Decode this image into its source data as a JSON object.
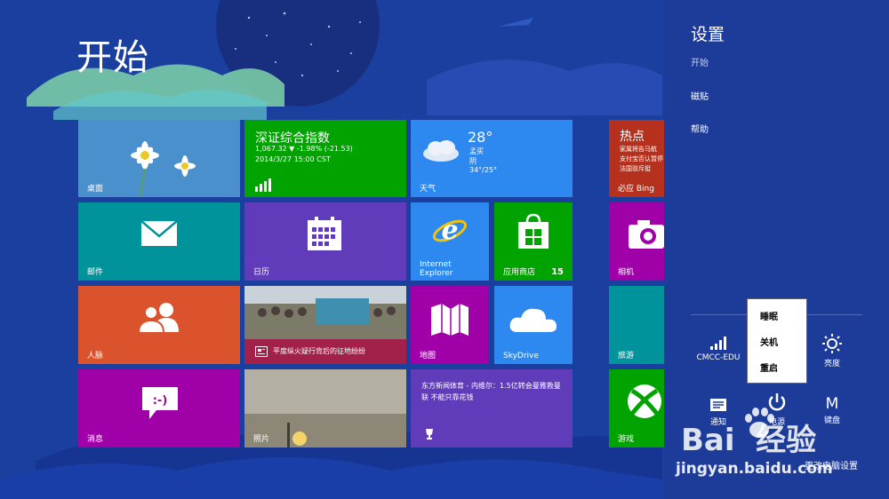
{
  "start": {
    "title": "开始"
  },
  "tiles": {
    "desktop": {
      "label": "桌面"
    },
    "stock": {
      "name": "深证综合指数",
      "line1": "1,067.32 ▼ -1.98% (-21.53)",
      "line2": "2014/3/27 15:00 CST"
    },
    "weather": {
      "temp": "28°",
      "city": "孟买",
      "cond": "阴",
      "range": "34°/25°",
      "label": "天气"
    },
    "news": {
      "title": "热点",
      "l1": "家属将告马航",
      "l2": "支付宝否认暂停",
      "l3": "法国驳斥挺",
      "label": "必应 Bing"
    },
    "mail": {
      "label": "邮件"
    },
    "calendar": {
      "label": "日历"
    },
    "ie": {
      "label": "Internet Explorer"
    },
    "store": {
      "label": "应用商店",
      "badge": "15"
    },
    "camera": {
      "label": "相机"
    },
    "people": {
      "label": "人脉"
    },
    "newsphoto": {
      "caption": "平度纵火疑行背后的征地纷纷"
    },
    "maps": {
      "label": "地图"
    },
    "skydrive": {
      "label": "SkyDrive"
    },
    "travel": {
      "label": "旅游"
    },
    "messaging": {
      "label": "消息"
    },
    "photos": {
      "label": "照片"
    },
    "sports": {
      "text": "东方新闻体育 - 内维尔：1.5亿转会曼雅救曼联 不能只靠花钱"
    },
    "games": {
      "label": "游戏"
    }
  },
  "charm": {
    "title": "设置",
    "subtitle": "开始",
    "items": [
      "磁贴",
      "帮助"
    ],
    "quick": {
      "network": "CMCC-EDU",
      "brightness": "亮度",
      "notifications": "通知",
      "power": "电源",
      "keyboard": "键盘",
      "keyboard_glyph": "M"
    },
    "power_menu": [
      "睡眠",
      "关机",
      "重启"
    ],
    "change_pc_settings": "更改电脑设置"
  },
  "watermark": {
    "brand": "Bai  经验",
    "url": "jingyan.baidu.com"
  },
  "colors": {
    "background": "#1b3f9e",
    "charm": "#1d3c9a",
    "green": "#00a300",
    "blue": "#2d89ef",
    "teal": "#00939b",
    "purple": "#603cba",
    "orange": "#da532c",
    "magenta": "#9f00a7"
  }
}
